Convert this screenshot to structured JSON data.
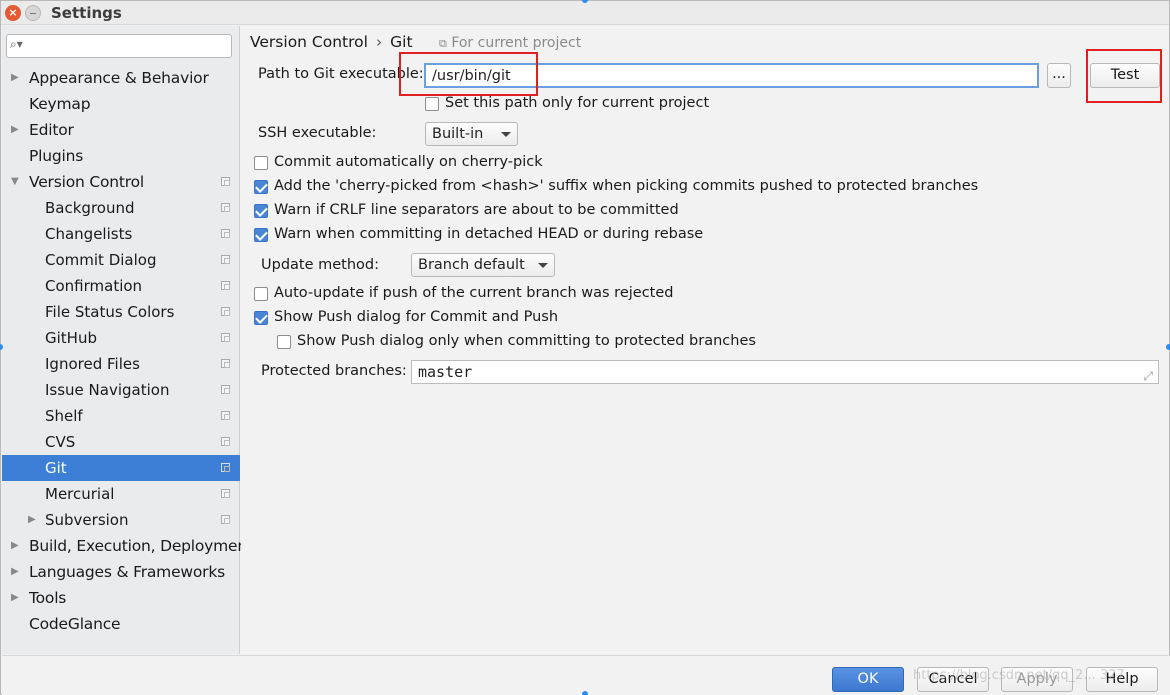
{
  "window": {
    "title": "Settings"
  },
  "sidebar": {
    "search_placeholder": "",
    "items": [
      {
        "label": "Appearance & Behavior",
        "level": 0,
        "arrow": "▶",
        "project": false
      },
      {
        "label": "Keymap",
        "level": 0,
        "arrow": "",
        "project": false
      },
      {
        "label": "Editor",
        "level": 0,
        "arrow": "▶",
        "project": false
      },
      {
        "label": "Plugins",
        "level": 0,
        "arrow": "",
        "project": false
      },
      {
        "label": "Version Control",
        "level": 0,
        "arrow": "▼",
        "project": true
      },
      {
        "label": "Background",
        "level": 1,
        "arrow": "",
        "project": true
      },
      {
        "label": "Changelists",
        "level": 1,
        "arrow": "",
        "project": true
      },
      {
        "label": "Commit Dialog",
        "level": 1,
        "arrow": "",
        "project": true
      },
      {
        "label": "Confirmation",
        "level": 1,
        "arrow": "",
        "project": true
      },
      {
        "label": "File Status Colors",
        "level": 1,
        "arrow": "",
        "project": true
      },
      {
        "label": "GitHub",
        "level": 1,
        "arrow": "",
        "project": true
      },
      {
        "label": "Ignored Files",
        "level": 1,
        "arrow": "",
        "project": true
      },
      {
        "label": "Issue Navigation",
        "level": 1,
        "arrow": "",
        "project": true
      },
      {
        "label": "Shelf",
        "level": 1,
        "arrow": "",
        "project": true
      },
      {
        "label": "CVS",
        "level": 1,
        "arrow": "",
        "project": true
      },
      {
        "label": "Git",
        "level": 1,
        "arrow": "",
        "project": true,
        "selected": true
      },
      {
        "label": "Mercurial",
        "level": 1,
        "arrow": "",
        "project": true
      },
      {
        "label": "Subversion",
        "level": 1,
        "arrow": "▶",
        "project": true
      },
      {
        "label": "Build, Execution, Deployment",
        "level": 0,
        "arrow": "▶",
        "project": false
      },
      {
        "label": "Languages & Frameworks",
        "level": 0,
        "arrow": "▶",
        "project": false
      },
      {
        "label": "Tools",
        "level": 0,
        "arrow": "▶",
        "project": false
      },
      {
        "label": "CodeGlance",
        "level": 0,
        "arrow": "",
        "project": false
      }
    ]
  },
  "breadcrumb": {
    "parent": "Version Control",
    "separator": "›",
    "current": "Git",
    "scope_note": "For current project"
  },
  "git": {
    "path_label": "Path to Git executable:",
    "path_value": "/usr/bin/git",
    "browse_label": "...",
    "test_label": "Test",
    "current_project_only_label": "Set this path only for current project",
    "current_project_only_checked": false,
    "ssh_label": "SSH executable:",
    "ssh_value": "Built-in",
    "options": [
      {
        "label": "Commit automatically on cherry-pick",
        "checked": false
      },
      {
        "label": "Add the 'cherry-picked from <hash>' suffix when picking commits pushed to protected branches",
        "checked": true
      },
      {
        "label": "Warn if CRLF line separators are about to be committed",
        "checked": true
      },
      {
        "label": "Warn when committing in detached HEAD or during rebase",
        "checked": true
      }
    ],
    "update_method_label": "Update method:",
    "update_method_value": "Branch default",
    "push_options": [
      {
        "label": "Auto-update if push of the current branch was rejected",
        "checked": false
      },
      {
        "label": "Show Push dialog for Commit and Push",
        "checked": true
      },
      {
        "label": "Show Push dialog only when committing to protected branches",
        "checked": false
      }
    ],
    "protected_branches_label": "Protected branches:",
    "protected_branches_value": "master"
  },
  "footer": {
    "ok_label": "OK",
    "cancel_label": "Cancel",
    "apply_label": "Apply",
    "help_label": "Help"
  },
  "watermark": "https://blog.csdn.net/qq_2... 327",
  "colors": {
    "selection": "#3d7ed6",
    "highlight_box": "#e02020",
    "ok_button": "#3c78d0"
  }
}
